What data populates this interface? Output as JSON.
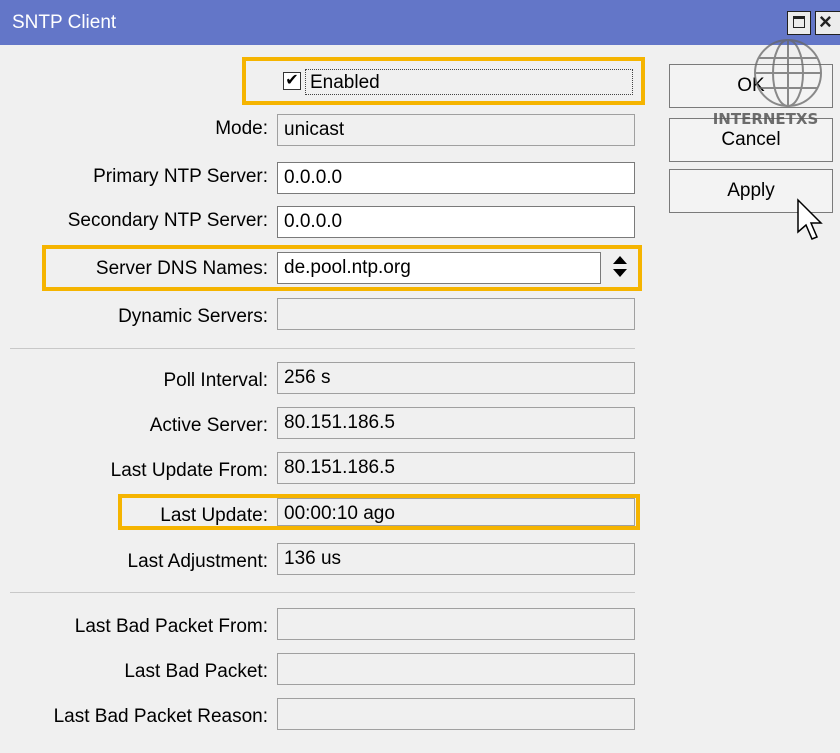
{
  "window": {
    "title": "SNTP Client"
  },
  "enabled": {
    "label": "Enabled",
    "checked": true
  },
  "fields": {
    "mode": {
      "label": "Mode:",
      "value": "unicast"
    },
    "primary_ntp": {
      "label": "Primary NTP Server:",
      "value": "0.0.0.0"
    },
    "secondary_ntp": {
      "label": "Secondary NTP Server:",
      "value": "0.0.0.0"
    },
    "server_dns": {
      "label": "Server DNS Names:",
      "value": "de.pool.ntp.org"
    },
    "dynamic_servers": {
      "label": "Dynamic Servers:",
      "value": ""
    },
    "poll_interval": {
      "label": "Poll Interval:",
      "value": "256 s"
    },
    "active_server": {
      "label": "Active Server:",
      "value": "80.151.186.5"
    },
    "last_update_from": {
      "label": "Last Update From:",
      "value": "80.151.186.5"
    },
    "last_update": {
      "label": "Last Update:",
      "value": "00:00:10 ago"
    },
    "last_adjustment": {
      "label": "Last Adjustment:",
      "value": "136 us"
    },
    "last_bad_packet_from": {
      "label": "Last Bad Packet From:",
      "value": ""
    },
    "last_bad_packet": {
      "label": "Last Bad Packet:",
      "value": ""
    },
    "last_bad_packet_reason": {
      "label": "Last Bad Packet Reason:",
      "value": ""
    }
  },
  "buttons": {
    "ok": "OK",
    "cancel": "Cancel",
    "apply": "Apply"
  },
  "watermark": {
    "text": "INTERNETXS"
  },
  "colors": {
    "titlebar": "#6376c8",
    "highlight": "#f5b400",
    "background": "#f0f0f0"
  },
  "icons": [
    "maximize-icon",
    "close-icon",
    "checkmark-icon",
    "dropdown-arrows-icon",
    "mouse-cursor-icon",
    "globe-logo-icon"
  ]
}
